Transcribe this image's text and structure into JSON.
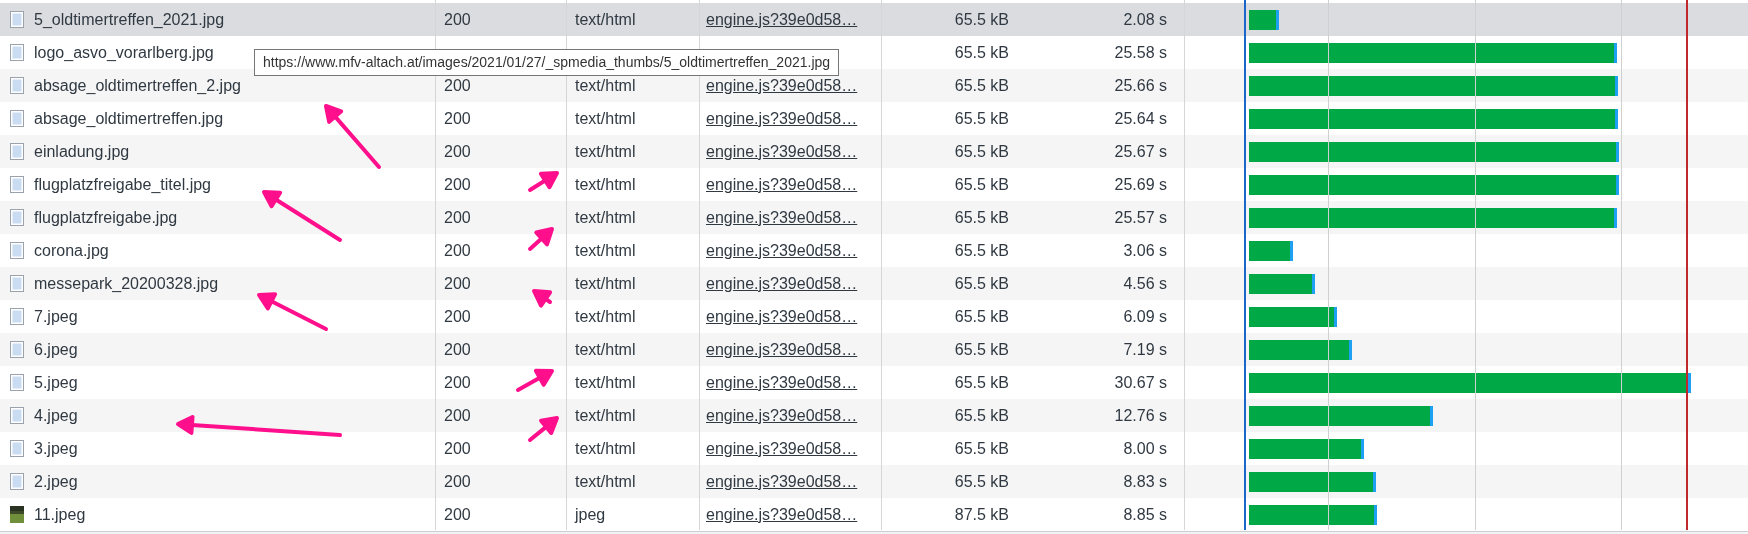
{
  "tooltip": "https://www.mfv-altach.at/images/2021/01/27/_spmedia_thumbs/5_oldtimertreffen_2021.jpg",
  "rows": [
    {
      "name": "5_oldtimertreffen_2021.jpg",
      "kind": "file",
      "status": "200",
      "type": "text/html",
      "initiator": "engine.js?39e0d58…",
      "size": "65.5 kB",
      "time": "2.08 s",
      "selected": true
    },
    {
      "name": "logo_asvo_vorarlberg.jpg",
      "kind": "file",
      "size": "65.5 kB",
      "time": "25.58 s",
      "selected": false
    },
    {
      "name": "absage_oldtimertreffen_2.jpg",
      "kind": "file",
      "status": "200",
      "type": "text/html",
      "initiator": "engine.js?39e0d58…",
      "size": "65.5 kB",
      "time": "25.66 s",
      "selected": false
    },
    {
      "name": "absage_oldtimertreffen.jpg",
      "kind": "file",
      "status": "200",
      "type": "text/html",
      "initiator": "engine.js?39e0d58…",
      "size": "65.5 kB",
      "time": "25.64 s",
      "selected": false
    },
    {
      "name": "einladung.jpg",
      "kind": "file",
      "status": "200",
      "type": "text/html",
      "initiator": "engine.js?39e0d58…",
      "size": "65.5 kB",
      "time": "25.67 s",
      "selected": false
    },
    {
      "name": "flugplatzfreigabe_titel.jpg",
      "kind": "file",
      "status": "200",
      "type": "text/html",
      "initiator": "engine.js?39e0d58…",
      "size": "65.5 kB",
      "time": "25.69 s",
      "selected": false
    },
    {
      "name": "flugplatzfreigabe.jpg",
      "kind": "file",
      "status": "200",
      "type": "text/html",
      "initiator": "engine.js?39e0d58…",
      "size": "65.5 kB",
      "time": "25.57 s",
      "selected": false
    },
    {
      "name": "corona.jpg",
      "kind": "file",
      "status": "200",
      "type": "text/html",
      "initiator": "engine.js?39e0d58…",
      "size": "65.5 kB",
      "time": "3.06 s",
      "selected": false
    },
    {
      "name": "messepark_20200328.jpg",
      "kind": "file",
      "status": "200",
      "type": "text/html",
      "initiator": "engine.js?39e0d58…",
      "size": "65.5 kB",
      "time": "4.56 s",
      "selected": false
    },
    {
      "name": "7.jpeg",
      "kind": "file",
      "status": "200",
      "type": "text/html",
      "initiator": "engine.js?39e0d58…",
      "size": "65.5 kB",
      "time": "6.09 s",
      "selected": false
    },
    {
      "name": "6.jpeg",
      "kind": "file",
      "status": "200",
      "type": "text/html",
      "initiator": "engine.js?39e0d58…",
      "size": "65.5 kB",
      "time": "7.19 s",
      "selected": false
    },
    {
      "name": "5.jpeg",
      "kind": "file",
      "status": "200",
      "type": "text/html",
      "initiator": "engine.js?39e0d58…",
      "size": "65.5 kB",
      "time": "30.67 s",
      "selected": false
    },
    {
      "name": "4.jpeg",
      "kind": "file",
      "status": "200",
      "type": "text/html",
      "initiator": "engine.js?39e0d58…",
      "size": "65.5 kB",
      "time": "12.76 s",
      "selected": false
    },
    {
      "name": "3.jpeg",
      "kind": "file",
      "status": "200",
      "type": "text/html",
      "initiator": "engine.js?39e0d58…",
      "size": "65.5 kB",
      "time": "8.00 s",
      "selected": false
    },
    {
      "name": "2.jpeg",
      "kind": "file",
      "status": "200",
      "type": "text/html",
      "initiator": "engine.js?39e0d58…",
      "size": "65.5 kB",
      "time": "8.83 s",
      "selected": false
    },
    {
      "name": "11.jpeg",
      "kind": "thumbnail",
      "status": "200",
      "type": "jpeg",
      "initiator": "engine.js?39e0d58…",
      "size": "87.5 kB",
      "time": "8.85 s",
      "selected": false
    }
  ]
}
